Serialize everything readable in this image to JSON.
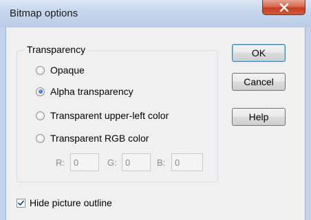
{
  "dialog": {
    "title": "Bitmap options"
  },
  "transparency": {
    "group_label": "Transparency",
    "options": [
      {
        "label": "Opaque",
        "checked": false
      },
      {
        "label": "Alpha transparency",
        "checked": true
      },
      {
        "label": "Transparent upper-left color",
        "checked": false
      },
      {
        "label": "Transparent RGB color",
        "checked": false
      }
    ],
    "rgb": {
      "r_label": "R:",
      "r_value": "0",
      "g_label": "G:",
      "g_value": "0",
      "b_label": "B:",
      "b_value": "0"
    }
  },
  "buttons": {
    "ok": "OK",
    "cancel": "Cancel",
    "help": "Help"
  },
  "hide_outline": {
    "label": "Hide picture outline",
    "checked": true
  },
  "icons": {
    "close": "close-icon",
    "check": "checkmark-icon"
  },
  "colors": {
    "radio_selected": "#2a6fc9",
    "close_button": "#c43f22"
  }
}
